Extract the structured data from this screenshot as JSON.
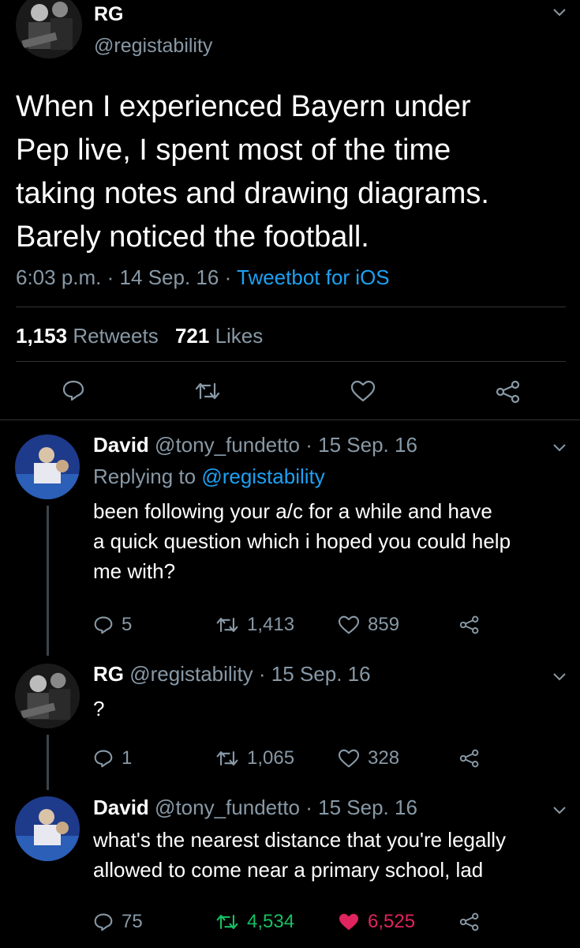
{
  "main_tweet": {
    "name": "RG",
    "handle": "@registability",
    "text_lines": [
      "When I experienced Bayern under",
      "Pep live, I spent most of the time",
      "taking notes and drawing diagrams.",
      "Barely noticed the football."
    ],
    "time": "6:03 p.m.",
    "sep": "·",
    "date": "14 Sep. 16",
    "source": "Tweetbot for iOS",
    "retweets_count": "1,153",
    "retweets_label": "Retweets",
    "likes_count": "721",
    "likes_label": "Likes"
  },
  "replies": [
    {
      "name": "David",
      "handle": "@tony_fundetto",
      "date": "· 15 Sep. 16",
      "replying_prefix": "Replying to",
      "replying_handle": "@registability",
      "text_lines": [
        "been following your a/c for a while and have",
        "a quick question which i hoped you could help",
        "me with?"
      ],
      "replies": "5",
      "retweets": "1,413",
      "likes": "859"
    },
    {
      "name": "RG",
      "handle": "@registability",
      "date": "· 15 Sep. 16",
      "text_lines": [
        "?"
      ],
      "replies": "1",
      "retweets": "1,065",
      "likes": "328"
    },
    {
      "name": "David",
      "handle": "@tony_fundetto",
      "date": "· 15 Sep. 16",
      "text_lines": [
        "what's the nearest distance that you're legally",
        "allowed to come near a primary school, lad"
      ],
      "replies": "75",
      "retweets": "4,534",
      "likes": "6,525"
    }
  ],
  "colors": {
    "background": "#000000",
    "muted": "#8899a6",
    "link": "#1da1f2",
    "retweeted": "#17bf63",
    "liked": "#e0245e"
  }
}
